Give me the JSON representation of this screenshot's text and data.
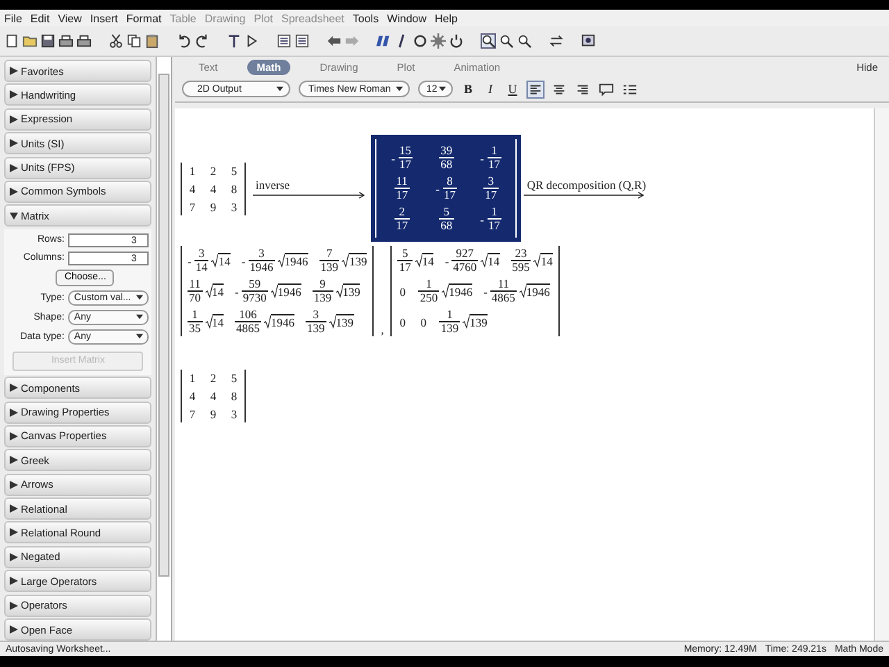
{
  "menu": [
    {
      "label": "File",
      "disabled": false
    },
    {
      "label": "Edit",
      "disabled": false
    },
    {
      "label": "View",
      "disabled": false
    },
    {
      "label": "Insert",
      "disabled": false
    },
    {
      "label": "Format",
      "disabled": false
    },
    {
      "label": "Table",
      "disabled": true
    },
    {
      "label": "Drawing",
      "disabled": true
    },
    {
      "label": "Plot",
      "disabled": true
    },
    {
      "label": "Spreadsheet",
      "disabled": true
    },
    {
      "label": "Tools",
      "disabled": false
    },
    {
      "label": "Window",
      "disabled": false
    },
    {
      "label": "Help",
      "disabled": false
    }
  ],
  "palettes": [
    {
      "label": "Favorites",
      "expanded": false
    },
    {
      "label": "Handwriting",
      "expanded": false
    },
    {
      "label": "Expression",
      "expanded": false
    },
    {
      "label": "Units (SI)",
      "expanded": false
    },
    {
      "label": "Units (FPS)",
      "expanded": false
    },
    {
      "label": "Common Symbols",
      "expanded": false
    },
    {
      "label": "Matrix",
      "expanded": true,
      "panel": {
        "rows": {
          "label": "Rows:",
          "value": "3"
        },
        "columns": {
          "label": "Columns:",
          "value": "3"
        },
        "choose": "Choose...",
        "type": {
          "label": "Type:",
          "value": "Custom val..."
        },
        "shape": {
          "label": "Shape:",
          "value": "Any"
        },
        "data_type": {
          "label": "Data type:",
          "value": "Any"
        },
        "insert": {
          "label": "Insert Matrix",
          "disabled": true
        }
      }
    },
    {
      "label": "Components",
      "expanded": false
    },
    {
      "label": "Drawing Properties",
      "expanded": false
    },
    {
      "label": "Canvas Properties",
      "expanded": false
    },
    {
      "label": "Greek",
      "expanded": false
    },
    {
      "label": "Arrows",
      "expanded": false
    },
    {
      "label": "Relational",
      "expanded": false
    },
    {
      "label": "Relational Round",
      "expanded": false
    },
    {
      "label": "Negated",
      "expanded": false
    },
    {
      "label": "Large Operators",
      "expanded": false
    },
    {
      "label": "Operators",
      "expanded": false
    },
    {
      "label": "Open Face",
      "expanded": false
    }
  ],
  "context_tabs": [
    {
      "label": "Text",
      "selected": false
    },
    {
      "label": "Math",
      "selected": true
    },
    {
      "label": "Drawing",
      "selected": false
    },
    {
      "label": "Plot",
      "selected": false
    },
    {
      "label": "Animation",
      "selected": false
    }
  ],
  "hide": "Hide",
  "format_bar": {
    "style": "2D Output",
    "font": "Times New Roman",
    "size": "12",
    "bold": "B",
    "italic": "I",
    "underline": "U",
    "align": [
      {
        "selected": true
      },
      {
        "selected": false
      },
      {
        "selected": false
      }
    ]
  },
  "document": [
    {
      "items": [
        {
          "kind": "matrix",
          "selected": false,
          "cells": [
            [
              {
                "value": "1"
              },
              {
                "value": "2"
              },
              {
                "value": "5"
              }
            ],
            [
              {
                "value": "4"
              },
              {
                "value": "4"
              },
              {
                "value": "8"
              }
            ],
            [
              {
                "value": "7"
              },
              {
                "value": "9"
              },
              {
                "value": "3"
              }
            ]
          ]
        },
        {
          "kind": "arrow",
          "label": "inverse"
        },
        {
          "kind": "matrix",
          "selected": true,
          "cells": [
            [
              {
                "sign": "-",
                "num": "15",
                "den": "17"
              },
              {
                "num": "39",
                "den": "68"
              },
              {
                "sign": "-",
                "num": "1",
                "den": "17"
              }
            ],
            [
              {
                "num": "11",
                "den": "17"
              },
              {
                "sign": "-",
                "num": "8",
                "den": "17"
              },
              {
                "num": "3",
                "den": "17"
              }
            ],
            [
              {
                "num": "2",
                "den": "17"
              },
              {
                "num": "5",
                "den": "68"
              },
              {
                "sign": "-",
                "num": "1",
                "den": "17"
              }
            ]
          ]
        },
        {
          "kind": "arrow",
          "label": "QR decomposition (Q,R)"
        }
      ]
    },
    {
      "items": [
        {
          "kind": "matrix",
          "selected": false,
          "cells": [
            [
              {
                "sign": "-",
                "num": "3",
                "den": "14",
                "root": "14"
              },
              {
                "sign": "-",
                "num": "3",
                "den": "1946",
                "root": "1946"
              },
              {
                "num": "7",
                "den": "139",
                "root": "139"
              }
            ],
            [
              {
                "num": "11",
                "den": "70",
                "root": "14"
              },
              {
                "sign": "-",
                "num": "59",
                "den": "9730",
                "root": "1946"
              },
              {
                "num": "9",
                "den": "139",
                "root": "139"
              }
            ],
            [
              {
                "num": "1",
                "den": "35",
                "root": "14"
              },
              {
                "num": "106",
                "den": "4865",
                "root": "1946"
              },
              {
                "num": "3",
                "den": "139",
                "root": "139"
              }
            ]
          ]
        },
        {
          "kind": "text",
          "text": ","
        },
        {
          "kind": "matrix",
          "selected": false,
          "cells": [
            [
              {
                "num": "5",
                "den": "17",
                "root": "14"
              },
              {
                "sign": "-",
                "num": "927",
                "den": "4760",
                "root": "14"
              },
              {
                "num": "23",
                "den": "595",
                "root": "14"
              }
            ],
            [
              {
                "value": "0"
              },
              {
                "num": "1",
                "den": "250",
                "root": "1946"
              },
              {
                "sign": "-",
                "num": "11",
                "den": "4865",
                "root": "1946"
              }
            ],
            [
              {
                "value": "0"
              },
              {
                "value": "0"
              },
              {
                "num": "1",
                "den": "139",
                "root": "139"
              }
            ]
          ]
        }
      ]
    },
    {
      "items": [
        {
          "kind": "matrix",
          "selected": false,
          "cells": [
            [
              {
                "value": "1"
              },
              {
                "value": "2"
              },
              {
                "value": "5"
              }
            ],
            [
              {
                "value": "4"
              },
              {
                "value": "4"
              },
              {
                "value": "8"
              }
            ],
            [
              {
                "value": "7"
              },
              {
                "value": "9"
              },
              {
                "value": "3"
              }
            ]
          ]
        }
      ]
    }
  ],
  "status_bar": {
    "message": "Autosaving Worksheet...",
    "memory": "Memory: 12.49M",
    "time": "Time: 249.21s",
    "mode": "Math Mode"
  }
}
